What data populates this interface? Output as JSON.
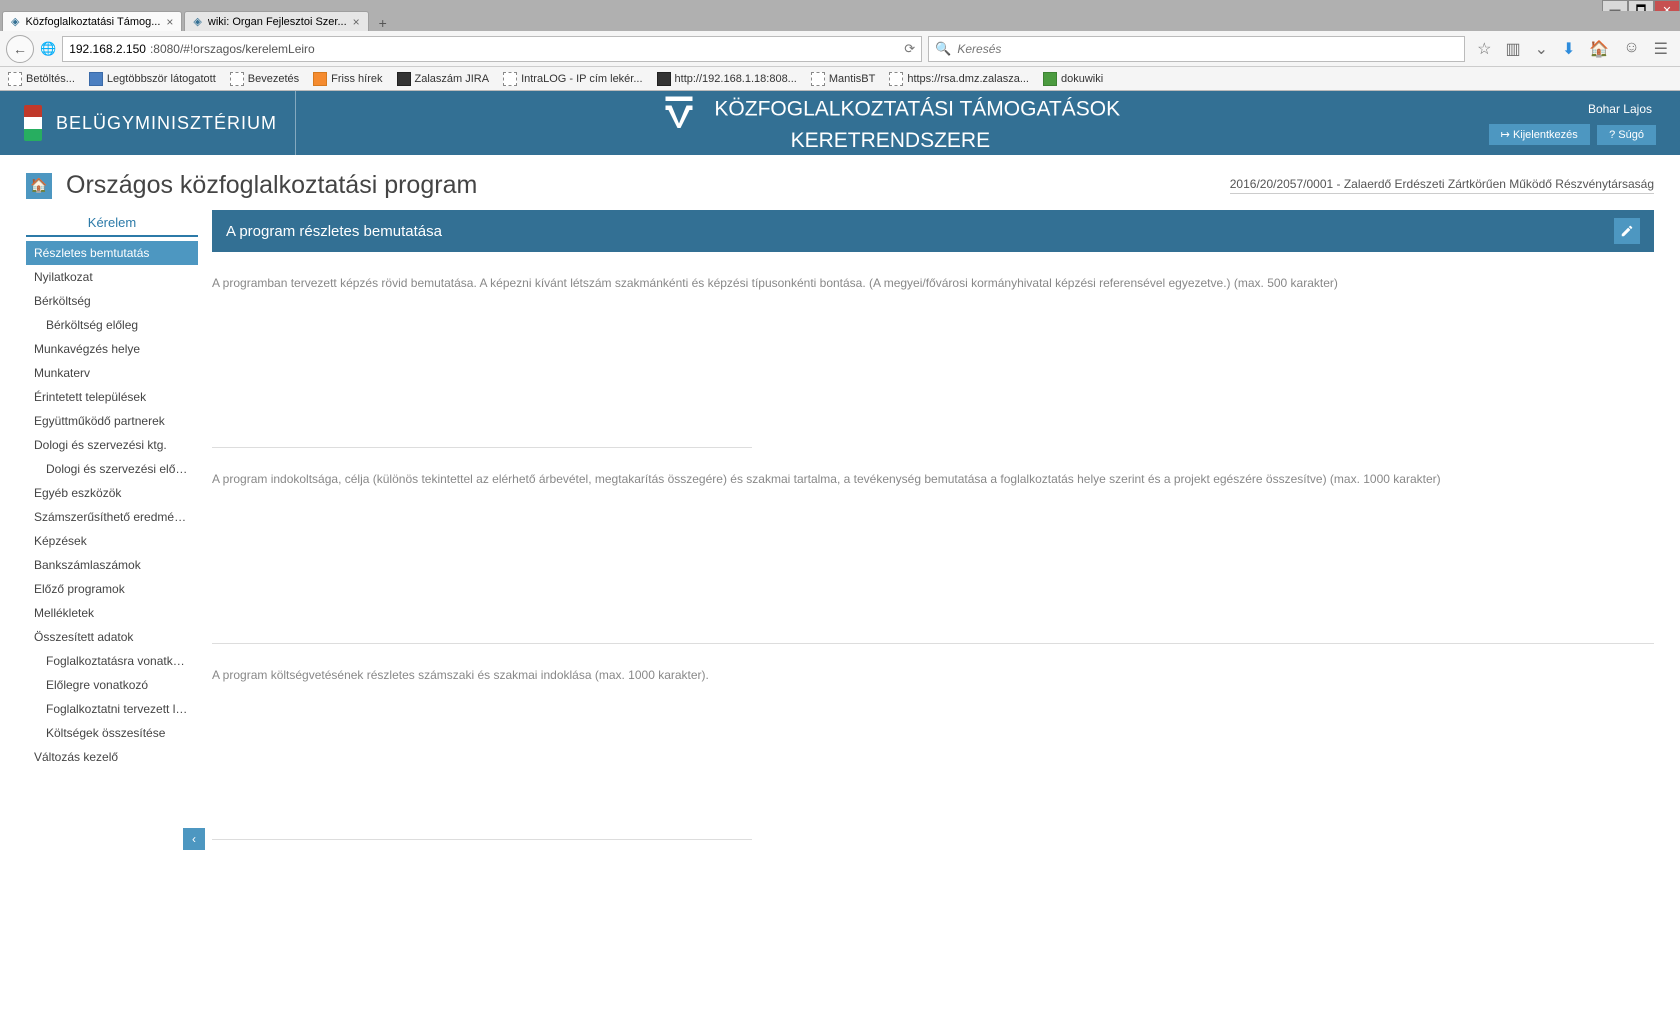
{
  "window": {
    "tabs": [
      {
        "title": "Közfoglalkoztatási Támog...",
        "active": true
      },
      {
        "title": "wiki: Organ Fejlesztoi Szer...",
        "active": false
      }
    ]
  },
  "nav": {
    "url_host": "192.168.2.150",
    "url_rest": ":8080/#!orszagos/kerelemLeiro",
    "search_placeholder": "Keresés"
  },
  "bookmarks": [
    {
      "label": "Betöltés...",
      "iconClass": "dashed"
    },
    {
      "label": "Legtöbbször látogatott",
      "iconClass": "blue"
    },
    {
      "label": "Bevezetés",
      "iconClass": "dashed"
    },
    {
      "label": "Friss hírek",
      "iconClass": "orange"
    },
    {
      "label": "Zalaszám JIRA",
      "iconClass": "dark"
    },
    {
      "label": "IntraLOG - IP cím lekér...",
      "iconClass": "dashed"
    },
    {
      "label": "http://192.168.1.18:808...",
      "iconClass": "dark"
    },
    {
      "label": "MantisBT",
      "iconClass": "dashed"
    },
    {
      "label": "https://rsa.dmz.zalasza...",
      "iconClass": "dashed"
    },
    {
      "label": "dokuwiki",
      "iconClass": "green"
    }
  ],
  "header": {
    "org": "BELÜGYMINISZTÉRIUM",
    "title_line1": "KÖZFOGLALKOZTATÁSI TÁMOGATÁSOK",
    "title_line2": "KERETRENDSZERE",
    "user": "Bohar Lajos",
    "logout": "Kijelentkezés",
    "help": "Súgó"
  },
  "page": {
    "title": "Országos közfoglalkoztatási program",
    "reference": "2016/20/2057/0001 - Zalaerdő Erdészeti Zártkörűen Működő Részvénytársaság"
  },
  "sidebar": {
    "header": "Kérelem",
    "items": [
      {
        "label": "Részletes bemtutatás",
        "active": true,
        "indent": false
      },
      {
        "label": "Nyilatkozat",
        "active": false,
        "indent": false
      },
      {
        "label": "Bérköltség",
        "active": false,
        "indent": false
      },
      {
        "label": "Bérköltség előleg",
        "active": false,
        "indent": true
      },
      {
        "label": "Munkavégzés helye",
        "active": false,
        "indent": false
      },
      {
        "label": "Munkaterv",
        "active": false,
        "indent": false
      },
      {
        "label": "Érintetett települések",
        "active": false,
        "indent": false
      },
      {
        "label": "Együttműködő partnerek",
        "active": false,
        "indent": false
      },
      {
        "label": "Dologi és szervezési ktg.",
        "active": false,
        "indent": false
      },
      {
        "label": "Dologi és szervezési előleg",
        "active": false,
        "indent": true
      },
      {
        "label": "Egyéb eszközök",
        "active": false,
        "indent": false
      },
      {
        "label": "Számszerűsíthető eredmény...",
        "active": false,
        "indent": false
      },
      {
        "label": "Képzések",
        "active": false,
        "indent": false
      },
      {
        "label": "Bankszámlaszámok",
        "active": false,
        "indent": false
      },
      {
        "label": "Előző programok",
        "active": false,
        "indent": false
      },
      {
        "label": "Mellékletek",
        "active": false,
        "indent": false
      },
      {
        "label": "Összesített adatok",
        "active": false,
        "indent": false
      },
      {
        "label": "Foglalkoztatásra vonatkozó",
        "active": false,
        "indent": true
      },
      {
        "label": "Előlegre vonatkozó",
        "active": false,
        "indent": true
      },
      {
        "label": "Foglalkoztatni tervezett lét...",
        "active": false,
        "indent": true
      },
      {
        "label": "Költségek összesítése",
        "active": false,
        "indent": true
      },
      {
        "label": "Változás kezelő",
        "active": false,
        "indent": false
      }
    ]
  },
  "content": {
    "panel_title": "A program részletes bemutatása",
    "sections": [
      {
        "label": "A programban tervezett képzés rövid bemutatása. A képezni kívánt létszám szakmánkénti és képzési típusonkénti bontása. (A megyei/fővárosi kormányhivatal képzési referensével egyezetve.) (max. 500 karakter)",
        "wide": false
      },
      {
        "label": "A program indokoltsága, célja (különös tekintettel az elérhető árbevétel, megtakarítás összegére) és szakmai tartalma, a tevékenység bemutatása a foglalkoztatás helye szerint és a projekt egészére összesítve) (max. 1000 karakter)",
        "wide": true
      },
      {
        "label": "A program költségvetésének részletes számszaki és szakmai indoklása (max. 1000 karakter).",
        "wide": false
      }
    ]
  }
}
